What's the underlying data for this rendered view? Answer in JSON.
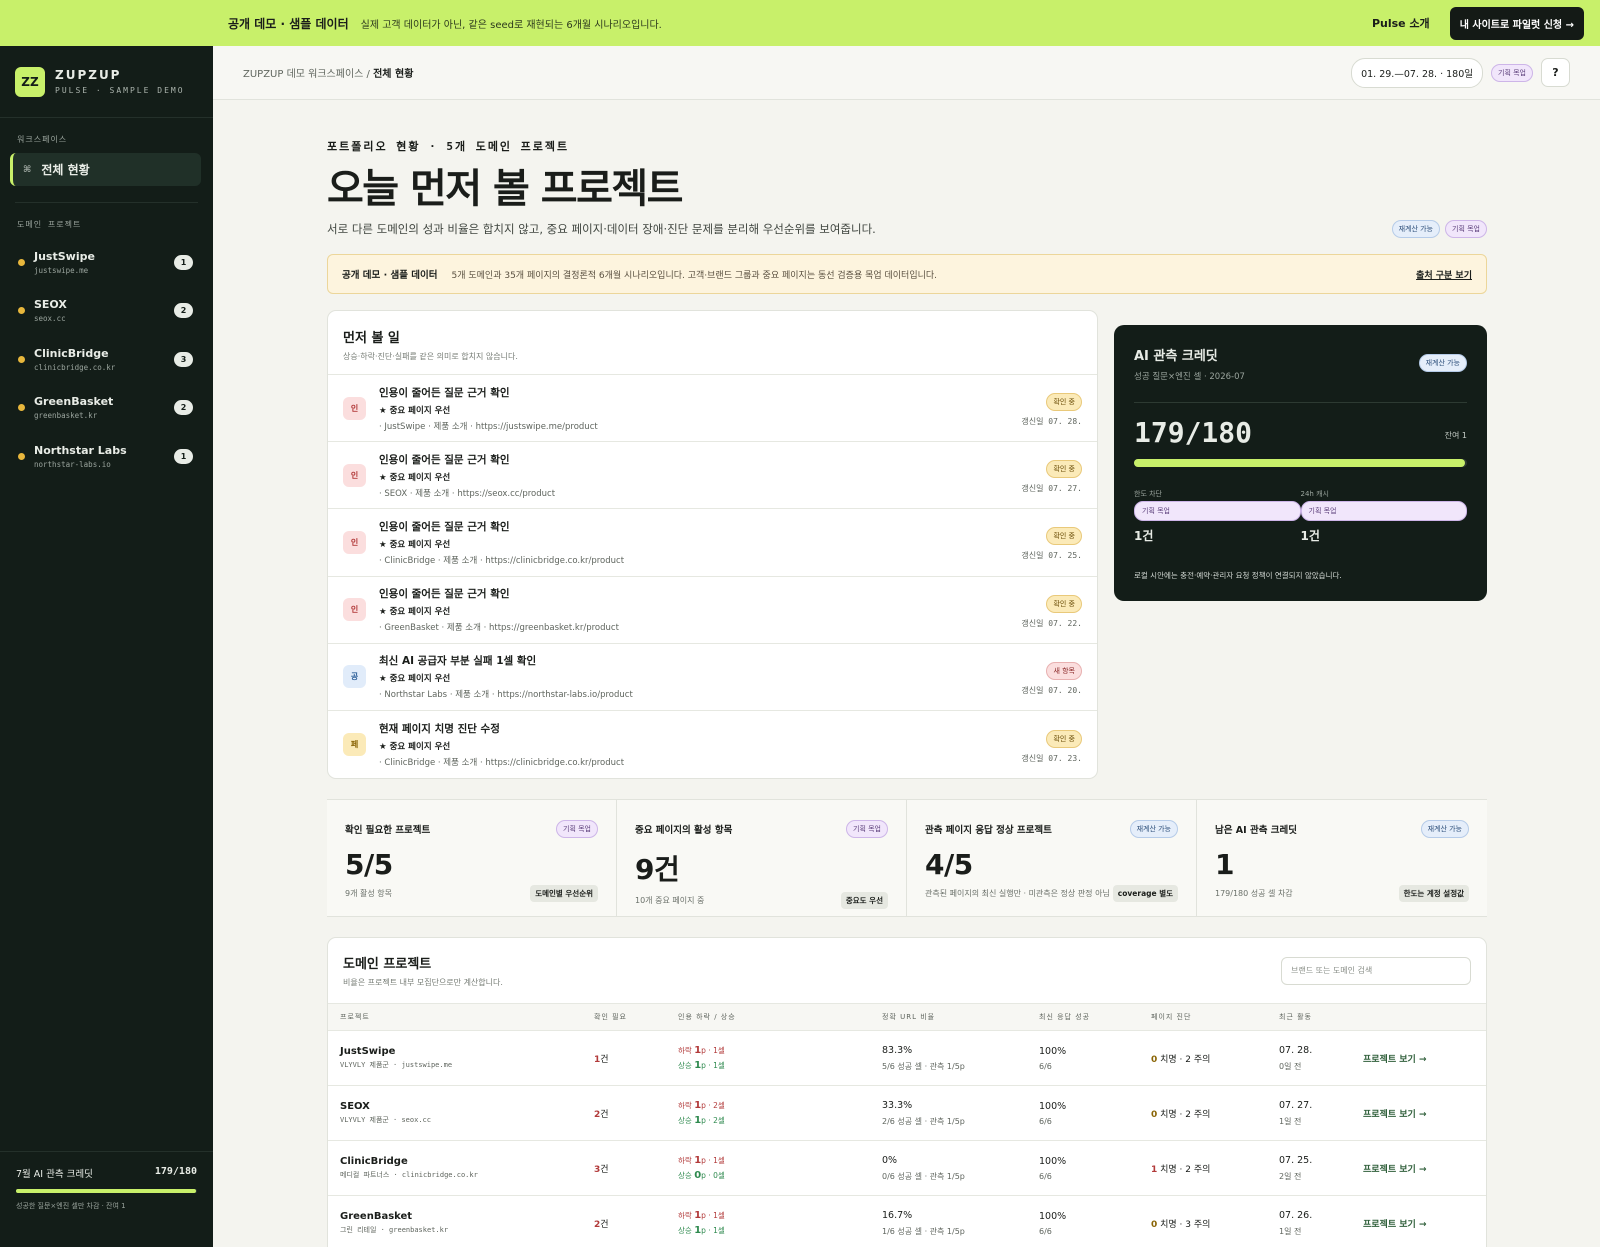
{
  "banner": {
    "title": "공개 데모 · 샘플 데이터",
    "desc": "실제 고객 데이터가 아닌, 같은 seed로 재현되는 6개월 시나리오입니다.",
    "link": "Pulse 소개",
    "cta": "내 사이트로 파일럿 신청 →"
  },
  "brand": {
    "mark": "ZZ",
    "name": "ZUPZUP",
    "sub": "PULSE · SAMPLE DEMO"
  },
  "sidebar": {
    "workspace_label": "워크스페이스",
    "active_icon": "⌘",
    "active": "전체 현황",
    "projects_label": "도메인 프로젝트",
    "projects": [
      {
        "name": "JustSwipe",
        "domain": "justswipe.me",
        "count": "1"
      },
      {
        "name": "SEOX",
        "domain": "seox.cc",
        "count": "2"
      },
      {
        "name": "ClinicBridge",
        "domain": "clinicbridge.co.kr",
        "count": "3"
      },
      {
        "name": "GreenBasket",
        "domain": "greenbasket.kr",
        "count": "2"
      },
      {
        "name": "Northstar Labs",
        "domain": "northstar-labs.io",
        "count": "1"
      }
    ],
    "footer": {
      "label": "7월 AI 관측 크레딧",
      "value": "179/180",
      "progress": 0.994,
      "sub": "성공한 질문×엔진 셀만 차감 · 잔여 1"
    }
  },
  "header": {
    "crumb_root": "ZUPZUP 데모 워크스페이스",
    "crumb_sep": "/",
    "crumb_current": "전체 현황",
    "date_range": "01. 29.—07. 28. · 180일",
    "mock_tag": "기획 목업",
    "help": "?"
  },
  "hero": {
    "eyebrow": "포트폴리오 현황 · 5개 도메인 프로젝트",
    "title": "오늘 먼저 볼 프로젝트",
    "lead": "서로 다른 도메인의 성과 비율은 합치지 않고, 중요 페이지·데이터 장애·진단 문제를 분리해 우선순위를 보여줍니다.",
    "tag1": "재계산 가능",
    "tag2": "기획 목업"
  },
  "notice": {
    "title": "공개 데모 · 샘플 데이터",
    "desc": "5개 도메인과 35개 페이지의 결정론적 6개월 시나리오입니다. 고객·브랜드 그룹과 중요 페이지는 동선 검증용 목업 데이터입니다.",
    "link": "출처 구분 보기"
  },
  "tasks": {
    "title": "먼저 볼 일",
    "subtitle": "상승·하락·진단·실패를 같은 의미로 합치지 않습니다.",
    "items": [
      {
        "icon": "인",
        "kind": "red",
        "title": "인용이 줄어든 질문 근거 확인",
        "priority": "★ 중요 페이지 우선",
        "source": "· JustSwipe · 제품 소개 · https://justswipe.me/product",
        "status": "확인 중",
        "status_kind": "amber",
        "date": "갱신일 07. 28."
      },
      {
        "icon": "인",
        "kind": "red",
        "title": "인용이 줄어든 질문 근거 확인",
        "priority": "★ 중요 페이지 우선",
        "source": "· SEOX · 제품 소개 · https://seox.cc/product",
        "status": "확인 중",
        "status_kind": "amber",
        "date": "갱신일 07. 27."
      },
      {
        "icon": "인",
        "kind": "red",
        "title": "인용이 줄어든 질문 근거 확인",
        "priority": "★ 중요 페이지 우선",
        "source": "· ClinicBridge · 제품 소개 · https://clinicbridge.co.kr/product",
        "status": "확인 중",
        "status_kind": "amber",
        "date": "갱신일 07. 25."
      },
      {
        "icon": "인",
        "kind": "red",
        "title": "인용이 줄어든 질문 근거 확인",
        "priority": "★ 중요 페이지 우선",
        "source": "· GreenBasket · 제품 소개 · https://greenbasket.kr/product",
        "status": "확인 중",
        "status_kind": "amber",
        "date": "갱신일 07. 22."
      },
      {
        "icon": "공",
        "kind": "blue",
        "title": "최신 AI 공급자 부분 실패 1셀 확인",
        "priority": "★ 중요 페이지 우선",
        "source": "· Northstar Labs · 제품 소개 · https://northstar-labs.io/product",
        "status": "새 항목",
        "status_kind": "red",
        "date": "갱신일 07. 20."
      },
      {
        "icon": "페",
        "kind": "amber",
        "title": "현재 페이지 치명 진단 수정",
        "priority": "★ 중요 페이지 우선",
        "source": "· ClinicBridge · 제품 소개 · https://clinicbridge.co.kr/product",
        "status": "확인 중",
        "status_kind": "amber",
        "date": "갱신일 07. 23."
      }
    ]
  },
  "credit": {
    "title": "AI 관측 크레딧",
    "subtitle": "성공 질문×엔진 셀 · 2026-07",
    "tag": "재계산 가능",
    "value": "179/180",
    "remaining": "잔여 1",
    "progress": 0.994,
    "cols": [
      {
        "label": "한도 차단",
        "tag": "기획 목업",
        "value": "1건"
      },
      {
        "label": "24h 캐시",
        "tag": "기획 목업",
        "value": "1건"
      }
    ],
    "note": "로컬 시안에는 충전·예약·관리자 요청 정책이 연결되지 않았습니다."
  },
  "kpis": [
    {
      "label": "확인 필요한 프로젝트",
      "tag": "기획 목업",
      "tag_kind": "purple",
      "value": "5/5",
      "desc": "9개 활성 항목",
      "chip": "도메인별 우선순위"
    },
    {
      "label": "중요 페이지의 활성 항목",
      "tag": "기획 목업",
      "tag_kind": "purple",
      "value": "9건",
      "desc": "10개 중요 페이지 중",
      "chip": "중요도 우선"
    },
    {
      "label": "관측 페이지 응답 정상 프로젝트",
      "tag": "재계산 가능",
      "tag_kind": "blue",
      "value": "4/5",
      "desc": "관측된 페이지의 최신 실행만 · 미관측은 정상 판정 아님",
      "chip": "coverage 별도"
    },
    {
      "label": "남은 AI 관측 크레딧",
      "tag": "재계산 가능",
      "tag_kind": "blue",
      "value": "1",
      "desc": "179/180 성공 셀 차감",
      "chip": "한도는 계정 설정값"
    }
  ],
  "domains": {
    "title": "도메인 프로젝트",
    "subtitle": "비율은 프로젝트 내부 모집단으로만 계산합니다.",
    "search_placeholder": "브랜드 또는 도메인 검색",
    "columns": [
      "프로젝트",
      "확인 필요",
      "인용 하락 / 상승",
      "정확 URL 비율",
      "최신 응답 성공",
      "페이지 진단",
      "최근 활동"
    ],
    "rows": [
      {
        "name": "JustSwipe",
        "group": "VLYVLY 제품군 · justswipe.me",
        "confirm_num": "1",
        "confirm_unit": "건",
        "down_label": "하락 ",
        "down_num": "1",
        "down_rest": "p · 1셀",
        "up_label": "상승 ",
        "up_num": "1",
        "up_rest": "p · 1셀",
        "url_ratio": "83.3%",
        "url_sub": "5/6 성공 셀 · 관측 1/5p",
        "resp": "100%",
        "resp_sub": "6/6",
        "diag_num": "0",
        "diag_kind": "a",
        "diag_rest": " 치명 · 2 주의",
        "date": "07. 28.",
        "ago": "0일 전",
        "link": "프로젝트 보기 →"
      },
      {
        "name": "SEOX",
        "group": "VLYVLY 제품군 · seox.cc",
        "confirm_num": "2",
        "confirm_unit": "건",
        "down_label": "하락 ",
        "down_num": "1",
        "down_rest": "p · 2셀",
        "up_label": "상승 ",
        "up_num": "1",
        "up_rest": "p · 2셀",
        "url_ratio": "33.3%",
        "url_sub": "2/6 성공 셀 · 관측 1/5p",
        "resp": "100%",
        "resp_sub": "6/6",
        "diag_num": "0",
        "diag_kind": "a",
        "diag_rest": " 치명 · 2 주의",
        "date": "07. 27.",
        "ago": "1일 전",
        "link": "프로젝트 보기 →"
      },
      {
        "name": "ClinicBridge",
        "group": "메디컬 파트너스 · clinicbridge.co.kr",
        "confirm_num": "3",
        "confirm_unit": "건",
        "down_label": "하락 ",
        "down_num": "1",
        "down_rest": "p · 1셀",
        "up_label": "상승 ",
        "up_num": "0",
        "up_rest": "p · 0셀",
        "url_ratio": "0%",
        "url_sub": "0/6 성공 셀 · 관측 1/5p",
        "resp": "100%",
        "resp_sub": "6/6",
        "diag_num": "1",
        "diag_kind": "r",
        "diag_rest": " 치명 · 2 주의",
        "date": "07. 25.",
        "ago": "2일 전",
        "link": "프로젝트 보기 →"
      },
      {
        "name": "GreenBasket",
        "group": "그린 리테일 · greenbasket.kr",
        "confirm_num": "2",
        "confirm_unit": "건",
        "down_label": "하락 ",
        "down_num": "1",
        "down_rest": "p · 1셀",
        "up_label": "상승 ",
        "up_num": "1",
        "up_rest": "p · 1셀",
        "url_ratio": "16.7%",
        "url_sub": "1/6 성공 셀 · 관측 1/5p",
        "resp": "100%",
        "resp_sub": "6/6",
        "diag_num": "0",
        "diag_kind": "a",
        "diag_rest": " 치명 · 3 주의",
        "date": "07. 26.",
        "ago": "1일 전",
        "link": "프로젝트 보기 →"
      }
    ]
  }
}
